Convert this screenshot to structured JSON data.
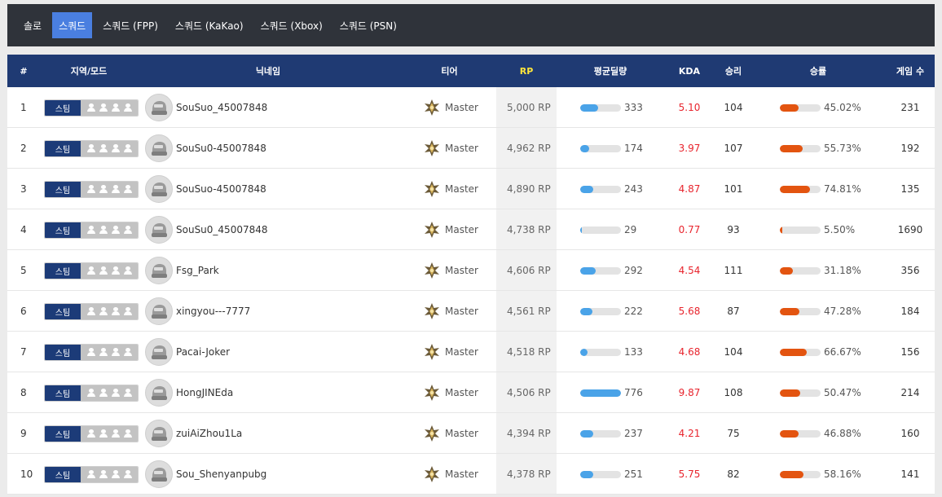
{
  "tabs": [
    {
      "label": "솔로",
      "active": false
    },
    {
      "label": "스쿼드",
      "active": true
    },
    {
      "label": "스쿼드 (FPP)",
      "active": false
    },
    {
      "label": "스쿼드 (KaKao)",
      "active": false
    },
    {
      "label": "스쿼드 (Xbox)",
      "active": false
    },
    {
      "label": "스쿼드 (PSN)",
      "active": false
    }
  ],
  "headers": {
    "rank": "#",
    "region": "지역/모드",
    "nickname": "닉네임",
    "tier": "티어",
    "rp": "RP",
    "avg_damage": "평균딜량",
    "kda": "KDA",
    "wins": "승리",
    "win_rate": "승률",
    "games": "게임 수"
  },
  "colors": {
    "tabbar_bg": "#2f333a",
    "tab_active": "#4a7fe0",
    "header_bg": "#1f3a73",
    "rp_header": "#ffe53b",
    "damage_bar": "#4aa3e8",
    "winrate_bar": "#e35410",
    "kda_text": "#e8242d"
  },
  "icons": {
    "mode": "squad-people-icon",
    "avatar": "helmet-avatar-icon",
    "tier": "master-tier-icon"
  },
  "rows": [
    {
      "rank": "1",
      "platform": "스팀",
      "nickname": "SouSuo_45007848",
      "tier": "Master",
      "rp": "5,000 RP",
      "avg_damage": "333",
      "damage_fraction": 0.43,
      "kda": "5.10",
      "wins": "104",
      "win_rate": "45.02%",
      "win_fraction": 0.4502,
      "games": "231"
    },
    {
      "rank": "2",
      "platform": "스팀",
      "nickname": "SouSu0-45007848",
      "tier": "Master",
      "rp": "4,962 RP",
      "avg_damage": "174",
      "damage_fraction": 0.22,
      "kda": "3.97",
      "wins": "107",
      "win_rate": "55.73%",
      "win_fraction": 0.5573,
      "games": "192"
    },
    {
      "rank": "3",
      "platform": "스팀",
      "nickname": "SouSuo-45007848",
      "tier": "Master",
      "rp": "4,890 RP",
      "avg_damage": "243",
      "damage_fraction": 0.31,
      "kda": "4.87",
      "wins": "101",
      "win_rate": "74.81%",
      "win_fraction": 0.7481,
      "games": "135"
    },
    {
      "rank": "4",
      "platform": "스팀",
      "nickname": "SouSu0_45007848",
      "tier": "Master",
      "rp": "4,738 RP",
      "avg_damage": "29",
      "damage_fraction": 0.04,
      "kda": "0.77",
      "wins": "93",
      "win_rate": "5.50%",
      "win_fraction": 0.055,
      "games": "1690"
    },
    {
      "rank": "5",
      "platform": "스팀",
      "nickname": "Fsg_Park",
      "tier": "Master",
      "rp": "4,606 RP",
      "avg_damage": "292",
      "damage_fraction": 0.38,
      "kda": "4.54",
      "wins": "111",
      "win_rate": "31.18%",
      "win_fraction": 0.3118,
      "games": "356"
    },
    {
      "rank": "6",
      "platform": "스팀",
      "nickname": "xingyou---7777",
      "tier": "Master",
      "rp": "4,561 RP",
      "avg_damage": "222",
      "damage_fraction": 0.29,
      "kda": "5.68",
      "wins": "87",
      "win_rate": "47.28%",
      "win_fraction": 0.4728,
      "games": "184"
    },
    {
      "rank": "7",
      "platform": "스팀",
      "nickname": "Pacai-Joker",
      "tier": "Master",
      "rp": "4,518 RP",
      "avg_damage": "133",
      "damage_fraction": 0.17,
      "kda": "4.68",
      "wins": "104",
      "win_rate": "66.67%",
      "win_fraction": 0.6667,
      "games": "156"
    },
    {
      "rank": "8",
      "platform": "스팀",
      "nickname": "HongJINEda",
      "tier": "Master",
      "rp": "4,506 RP",
      "avg_damage": "776",
      "damage_fraction": 1.0,
      "kda": "9.87",
      "wins": "108",
      "win_rate": "50.47%",
      "win_fraction": 0.5047,
      "games": "214"
    },
    {
      "rank": "9",
      "platform": "스팀",
      "nickname": "zuiAiZhou1La",
      "tier": "Master",
      "rp": "4,394 RP",
      "avg_damage": "237",
      "damage_fraction": 0.31,
      "kda": "4.21",
      "wins": "75",
      "win_rate": "46.88%",
      "win_fraction": 0.4688,
      "games": "160"
    },
    {
      "rank": "10",
      "platform": "스팀",
      "nickname": "Sou_Shenyanpubg",
      "tier": "Master",
      "rp": "4,378 RP",
      "avg_damage": "251",
      "damage_fraction": 0.32,
      "kda": "5.75",
      "wins": "82",
      "win_rate": "58.16%",
      "win_fraction": 0.5816,
      "games": "141"
    }
  ]
}
